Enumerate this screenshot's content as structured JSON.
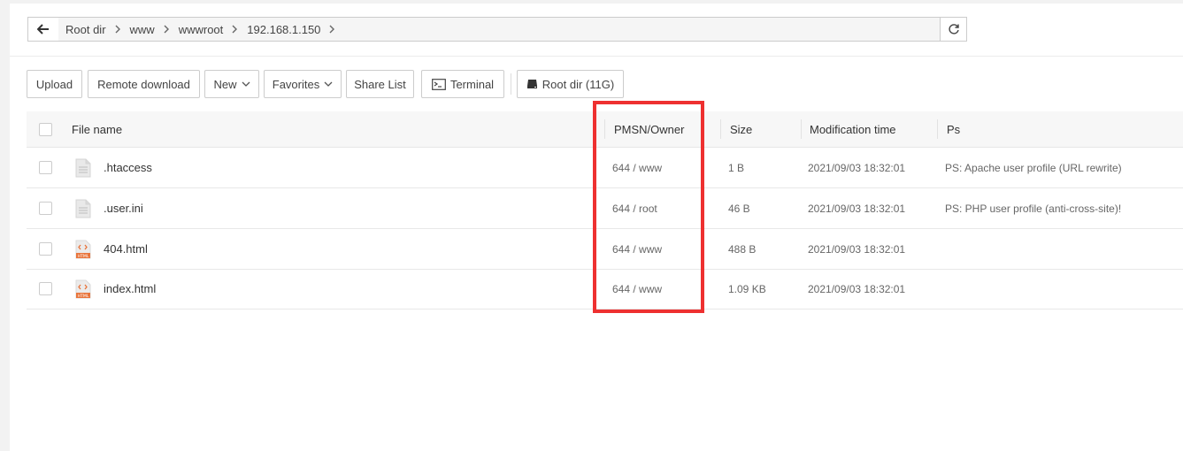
{
  "breadcrumbs": [
    "Root dir",
    "www",
    "wwwroot",
    "192.168.1.150"
  ],
  "toolbar": {
    "upload": "Upload",
    "remote_download": "Remote download",
    "new": "New",
    "favorites": "Favorites",
    "share_list": "Share List",
    "terminal": "Terminal",
    "root_dir": "Root dir (11G)"
  },
  "table": {
    "headers": {
      "file_name": "File name",
      "pmsn_owner": "PMSN/Owner",
      "size": "Size",
      "mod_time": "Modification time",
      "ps": "Ps"
    },
    "rows": [
      {
        "name": ".htaccess",
        "icon": "text-file-icon",
        "perm": "644 / www",
        "size": "1 B",
        "mtime": "2021/09/03 18:32:01",
        "ps": "PS: Apache user profile (URL rewrite)"
      },
      {
        "name": ".user.ini",
        "icon": "text-file-icon",
        "perm": "644 / root",
        "size": "46 B",
        "mtime": "2021/09/03 18:32:01",
        "ps": "PS: PHP user profile (anti-cross-site)!"
      },
      {
        "name": "404.html",
        "icon": "html-file-icon",
        "perm": "644 / www",
        "size": "488 B",
        "mtime": "2021/09/03 18:32:01",
        "ps": ""
      },
      {
        "name": "index.html",
        "icon": "html-file-icon",
        "perm": "644 / www",
        "size": "1.09 KB",
        "mtime": "2021/09/03 18:32:01",
        "ps": ""
      }
    ]
  },
  "colors": {
    "highlight": "#ee3030",
    "html_icon": "#e8743b"
  }
}
